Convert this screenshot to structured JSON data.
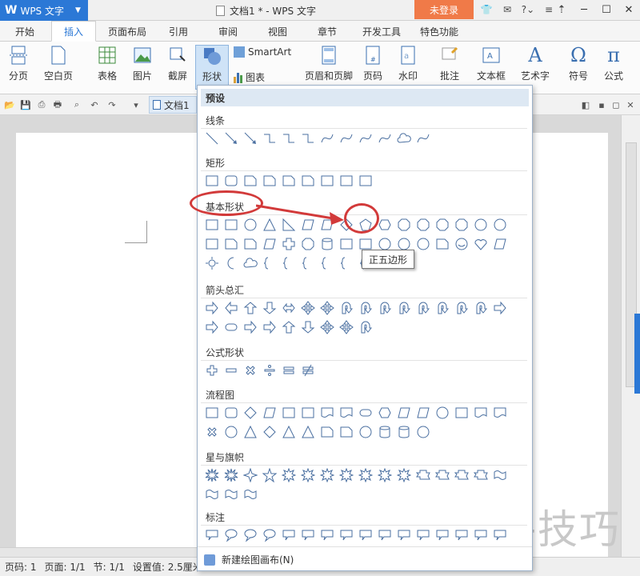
{
  "titlebar": {
    "app_label": "WPS 文字",
    "doc_title": "文档1 * - WPS 文字",
    "login_label": "未登录",
    "icons": [
      "shirt-icon",
      "chat-icon",
      "help-icon",
      "menu-icon"
    ]
  },
  "tabs": [
    "开始",
    "插入",
    "页面布局",
    "引用",
    "审阅",
    "视图",
    "章节",
    "开发工具",
    "特色功能"
  ],
  "active_tab": "插入",
  "ribbon": {
    "page_break": "分页",
    "blank_page": "空白页",
    "table": "表格",
    "picture": "图片",
    "screenshot": "截屏",
    "shapes": "形状",
    "smartart": "SmartArt",
    "chart": "图表",
    "header_footer": "页眉和页脚",
    "page_number": "页码",
    "watermark": "水印",
    "comment": "批注",
    "textbox": "文本框",
    "wordart": "艺术字",
    "symbol": "符号",
    "formula": "公式"
  },
  "doc_tab": "文档1",
  "shapes_panel": {
    "header": "预设",
    "sections": {
      "lines": "线条",
      "rectangles": "矩形",
      "basic": "基本形状",
      "arrows": "箭头总汇",
      "formula": "公式形状",
      "flowchart": "流程图",
      "stars": "星与旗帜",
      "callouts": "标注"
    },
    "footer": "新建绘图画布(N)",
    "tooltip": "正五边形"
  },
  "statusbar": {
    "page_num": "页码: 1",
    "pages": "页面: 1/1",
    "section": "节: 1/1",
    "settings": "设置值: 2.5厘米"
  },
  "watermark_text": "软件技巧",
  "colors": {
    "accent": "#2b78d6",
    "login": "#f07a48",
    "annotation": "#d23a3a"
  }
}
